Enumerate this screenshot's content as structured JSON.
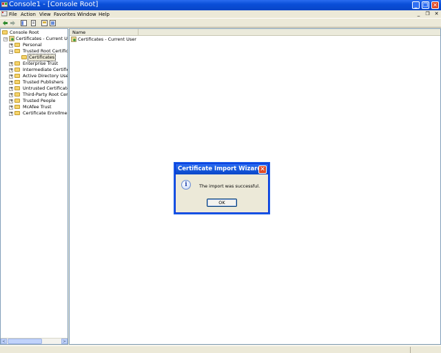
{
  "window": {
    "title": "Console1 - [Console Root]",
    "minimize": "_",
    "restore": "❐",
    "close": "✕"
  },
  "menu": {
    "items": [
      "File",
      "Action",
      "View",
      "Favorites",
      "Window",
      "Help"
    ],
    "mdi_minimize": "_",
    "mdi_restore": "❐",
    "mdi_close": "✕"
  },
  "tree": {
    "root": "Console Root",
    "nodes": [
      {
        "label": "Certificates - Current User",
        "expander": "−"
      },
      {
        "label": "Personal",
        "expander": "+"
      },
      {
        "label": "Trusted Root Certification Authorities",
        "expander": "−"
      },
      {
        "label": "Certificates",
        "expander": ""
      },
      {
        "label": "Enterprise Trust",
        "expander": "+"
      },
      {
        "label": "Intermediate Certification Authorities",
        "expander": "+"
      },
      {
        "label": "Active Directory User Object",
        "expander": "+"
      },
      {
        "label": "Trusted Publishers",
        "expander": "+"
      },
      {
        "label": "Untrusted Certificates",
        "expander": "+"
      },
      {
        "label": "Third-Party Root Certification Authorities",
        "expander": "+"
      },
      {
        "label": "Trusted People",
        "expander": "+"
      },
      {
        "label": "McAfee Trust",
        "expander": "+"
      },
      {
        "label": "Certificate Enrollment Requests",
        "expander": "+"
      }
    ]
  },
  "list": {
    "column_name": "Name",
    "items": [
      "Certificates - Current User"
    ]
  },
  "dialog": {
    "title": "Certificate Import Wizard",
    "message": "The import was successful.",
    "ok_label": "OK",
    "close": "✕",
    "icon": "i"
  },
  "scroll": {
    "left": "<",
    "right": ">"
  },
  "colors": {
    "titlebar": "#0a4fd8",
    "close": "#e04b26"
  }
}
